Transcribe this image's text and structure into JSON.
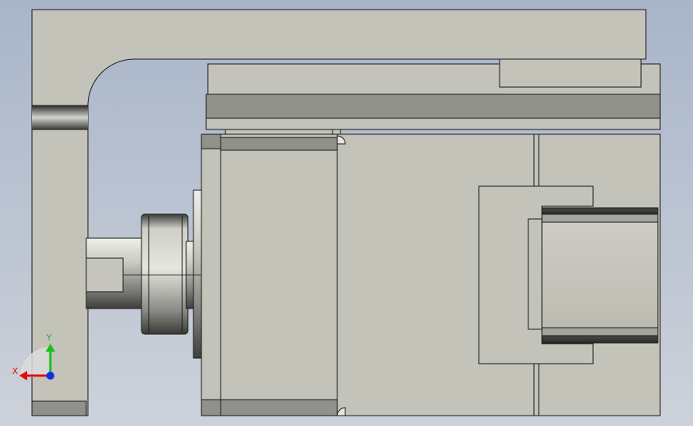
{
  "viewport": {
    "background_top": "#a9b6c9",
    "background_bottom": "#c8ced8"
  },
  "colors": {
    "part_face": "#c3c3b9",
    "part_edge": "#1a1a1a",
    "part_dark": "#8f918a",
    "part_darker": "#5b5d58",
    "shaft_light": "#d9d9d2",
    "shaft_dark": "#4a4b47"
  },
  "triad": {
    "x_label": "X",
    "y_label": "Y",
    "x_color": "#e01010",
    "y_color": "#18c018",
    "z_color": "#1030e0"
  }
}
